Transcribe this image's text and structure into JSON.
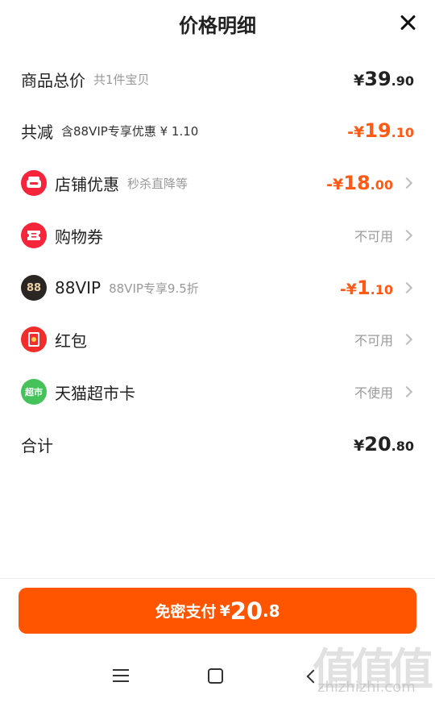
{
  "header": {
    "title": "价格明细"
  },
  "total_goods": {
    "label": "商品总价",
    "sub": "共1件宝贝",
    "yen": "¥",
    "int": "39",
    "dec": ".90"
  },
  "total_reduce": {
    "label": "共减",
    "sub": "含88VIP专享优惠 ¥ 1.10",
    "yen": "-¥",
    "int": "19",
    "dec": ".10"
  },
  "rows": [
    {
      "label": "店铺优惠",
      "sub": "秒杀直降等",
      "yen": "-¥",
      "int": "18",
      "dec": ".00",
      "icon": "shop-coupon-icon"
    },
    {
      "label": "购物券",
      "status": "不可用",
      "icon": "ticket-icon"
    },
    {
      "label": "88VIP",
      "sub": "88VIP专享9.5折",
      "yen": "-¥",
      "int": "1",
      "dec": ".10",
      "icon": "vip-88-icon",
      "icon_text": "88"
    },
    {
      "label": "红包",
      "status": "不可用",
      "icon": "red-envelope-icon"
    },
    {
      "label": "天猫超市卡",
      "status": "不使用",
      "icon": "tmall-supermarket-card-icon",
      "icon_text": "超市"
    }
  ],
  "sum": {
    "label": "合计",
    "yen": "¥",
    "int": "20",
    "dec": ".80"
  },
  "pay_button": {
    "label": "免密支付",
    "yen": "¥",
    "int": "20",
    "dec": ".8"
  },
  "watermark": {
    "chars": [
      "值",
      "值",
      "值"
    ],
    "url": "zhizhizhi.com"
  },
  "colors": {
    "accent": "#ff5500",
    "discount": "#ff5a16",
    "muted": "#999999"
  }
}
